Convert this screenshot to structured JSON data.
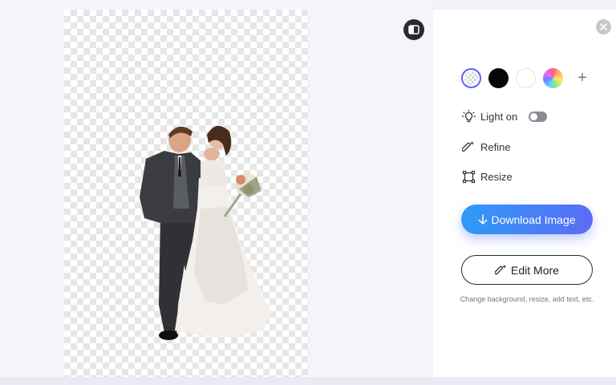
{
  "canvas": {
    "compare_icon": "split-view-icon",
    "subject_description_icon": "cutout-image"
  },
  "panel": {
    "close_icon": "close-icon",
    "background_colors": [
      "transparent",
      "#050505",
      "#ffffff",
      "rainbow"
    ],
    "selected_color": "transparent",
    "add_color_icon": "plus-icon",
    "add_color_label": "+",
    "light_label": "Light on",
    "light_toggle_on": false,
    "refine_label": "Refine",
    "resize_label": "Resize",
    "download_label": "Download Image",
    "edit_more_label": "Edit More",
    "hint": "Change background, resize, add text, etc."
  },
  "colors": {
    "accent": "#5b63f2",
    "download_gradient_start": "#2f9af7",
    "download_gradient_end": "#5b6cf5"
  }
}
